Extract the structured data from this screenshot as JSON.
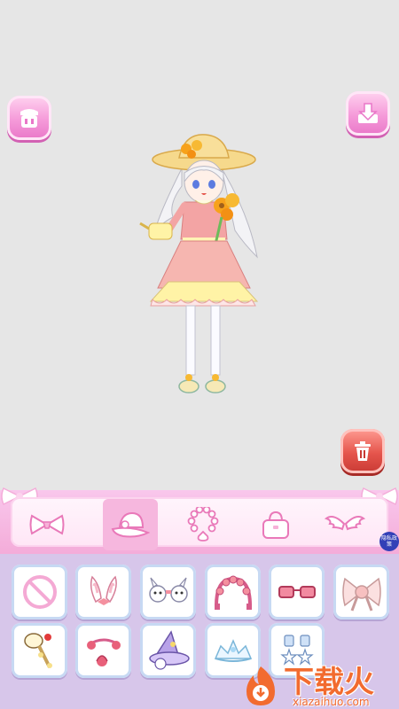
{
  "toolbar": {
    "clear_icon": "basket-icon",
    "save_icon": "download-icon",
    "delete_icon": "trash-icon"
  },
  "categories": [
    {
      "name": "bow",
      "icon": "bow-icon",
      "active": false
    },
    {
      "name": "hat",
      "icon": "hat-icon",
      "active": true
    },
    {
      "name": "necklace",
      "icon": "necklace-icon",
      "active": false
    },
    {
      "name": "bag",
      "icon": "bag-icon",
      "active": false
    },
    {
      "name": "wings",
      "icon": "wings-icon",
      "active": false
    }
  ],
  "privacy_badge": "隐私政策",
  "items": [
    {
      "icon": "none-icon"
    },
    {
      "icon": "bunny-ears-icon"
    },
    {
      "icon": "bunny-clips-icon"
    },
    {
      "icon": "flower-headband-icon"
    },
    {
      "icon": "glasses-icon"
    },
    {
      "icon": "flower-bow-icon"
    },
    {
      "icon": "bunny-hairpin-icon"
    },
    {
      "icon": "rose-headband-icon"
    },
    {
      "icon": "witch-hat-icon"
    },
    {
      "icon": "tiara-icon"
    },
    {
      "icon": "star-earrings-icon"
    }
  ],
  "watermark": {
    "title": "下载火",
    "url": "xiazaihuo.com"
  },
  "colors": {
    "accent_pink": "#f59ad9",
    "delete_red": "#e5554c",
    "panel_lilac": "#d7c6ea",
    "watermark_orange": "#f26b2f"
  }
}
